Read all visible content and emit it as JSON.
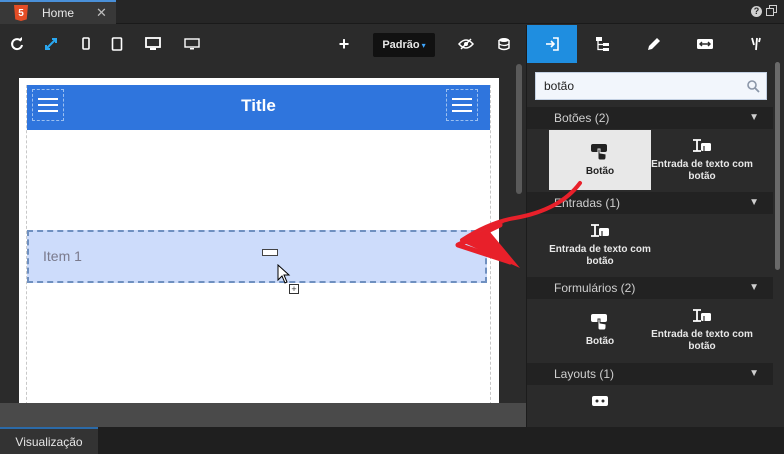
{
  "tab": {
    "label": "Home",
    "close": "✕",
    "help": "?"
  },
  "toolbar": {
    "preset_label": "Padrão",
    "preset_caret": "▾",
    "add": "+"
  },
  "canvas": {
    "app_title": "Title",
    "list_item_label": "Item 1",
    "plus": "+"
  },
  "panel": {
    "search_value": "botão",
    "sections": [
      {
        "title": "Botões (2)",
        "items": [
          "Botão",
          "Entrada de texto com botão"
        ]
      },
      {
        "title": "Entradas (1)",
        "items": [
          "Entrada de texto com botão"
        ]
      },
      {
        "title": "Formulários (2)",
        "items": [
          "Botão",
          "Entrada de texto com botão"
        ]
      },
      {
        "title": "Layouts (1)",
        "items": []
      }
    ]
  },
  "status": {
    "visualizacao": "Visualização"
  },
  "colors": {
    "accent": "#1f8ee0",
    "appbar": "#2f75dd",
    "arrow": "#e8202a"
  }
}
